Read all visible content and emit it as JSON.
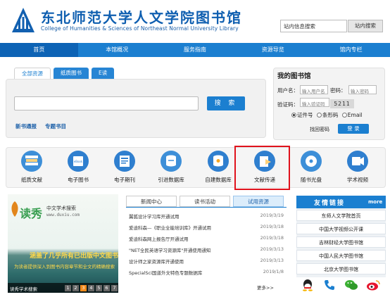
{
  "header": {
    "title_cn": "东北师范大学人文学院图书馆",
    "title_en": "College of Humanities & Sciences of Northeast Normal University Library",
    "site_search_placeholder": "站内信息搜索",
    "site_search_button": "站内搜索"
  },
  "nav": [
    "首页",
    "本馆概况",
    "服务指南",
    "资源导览",
    "馆内专栏"
  ],
  "search": {
    "tabs": [
      "全部资源",
      "纸质图书",
      "E读"
    ],
    "button": "搜 索",
    "links": [
      "新书通报",
      "专题书目"
    ]
  },
  "mylib": {
    "title": "我的图书馆",
    "user_label": "用户名：",
    "user_placeholder": "输入用户名",
    "pwd_label": "密码：",
    "pwd_placeholder": "输入密码",
    "captcha_label": "验证码：",
    "captcha_placeholder": "输入验证码",
    "captcha": "5211",
    "radios": [
      "证件号",
      "条形码",
      "Email"
    ],
    "forgot": "找回密码",
    "login": "登 录"
  },
  "services": [
    {
      "label": "纸质文献",
      "icon": "book-stack-icon",
      "color": "#3d8fd8"
    },
    {
      "label": "电子图书",
      "icon": "ebook-icon",
      "color": "#2f7fcf"
    },
    {
      "label": "电子期刊",
      "icon": "journal-icon",
      "color": "#2f7fcf"
    },
    {
      "label": "引进数据库",
      "icon": "database-import-icon",
      "color": "#3d8fd8"
    },
    {
      "label": "自建数据库",
      "icon": "database-build-icon",
      "color": "#2f7fcf"
    },
    {
      "label": "文献传递",
      "icon": "document-delivery-icon",
      "color": "#2f7fcf"
    },
    {
      "label": "随书光盘",
      "icon": "cd-icon",
      "color": "#3d8fd8"
    },
    {
      "label": "学术视频",
      "icon": "video-icon",
      "color": "#2f7fcf"
    }
  ],
  "banner": {
    "brand": "读秀",
    "sub": "中文学术搜索",
    "url": "www.duxiu.com",
    "headline": "涵盖了几乎所有已出版中文图书",
    "desc": "为读者提供深入到图书内容章节和全文的精确搜索",
    "caption": "读秀学术搜索",
    "pages": [
      "1",
      "2",
      "3",
      "4",
      "5",
      "6",
      "7"
    ],
    "active_page": "3"
  },
  "news": {
    "tabs": [
      "新闻中心",
      "读书活动",
      "试用资源"
    ],
    "active_tab": "试用资源",
    "items": [
      {
        "title": "翼狐设计学习库开通试用",
        "date": "2019/3/19"
      },
      {
        "title": "爱迪科森—《职业全能培训库》开通试用",
        "date": "2019/3/18"
      },
      {
        "title": "爱迪科森网上报告厅开通试用",
        "date": "2019/3/18"
      },
      {
        "title": "\"NET全民英语学习资源库\"开通使用通知",
        "date": "2019/3/13"
      },
      {
        "title": "设计师之家资源库开通使用",
        "date": "2019/3/13"
      },
      {
        "title": "SpecialSci国道外文特色专题数据库",
        "date": "2019/1/8"
      }
    ],
    "more": "更多>>"
  },
  "friend_links": {
    "title": "友情链接",
    "more": "more",
    "items": [
      "东师人文学院首页",
      "中国大学视频公开课",
      "吉林财经大学图书馆",
      "中国人民大学图书馆",
      "北京大学图书馆"
    ]
  },
  "social": [
    "qq-icon",
    "phone-icon",
    "wechat-icon",
    "weibo-icon"
  ]
}
